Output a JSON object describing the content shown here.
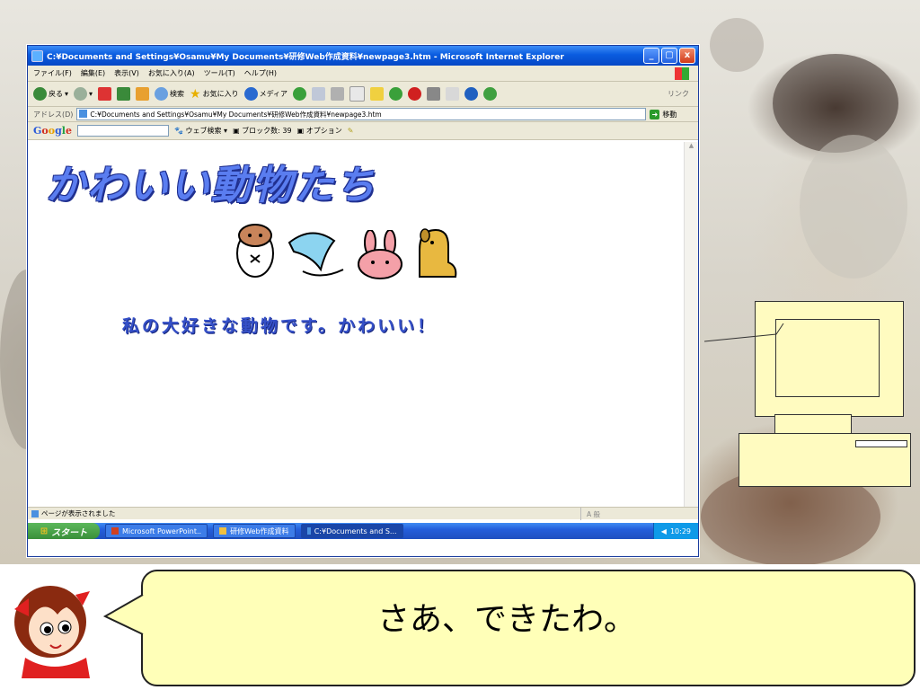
{
  "window": {
    "title": "C:¥Documents and Settings¥Osamu¥My Documents¥研修Web作成資料¥newpage3.htm - Microsoft Internet Explorer",
    "controls": [
      "_",
      "▢",
      "x"
    ]
  },
  "menubar": {
    "items": [
      "ファイル(F)",
      "編集(E)",
      "表示(V)",
      "お気に入り(A)",
      "ツール(T)",
      "ヘルプ(H)"
    ]
  },
  "toolbar": {
    "back": "戻る",
    "search": "検索",
    "favorites": "お気に入り",
    "media": "メディア",
    "links": "リンク"
  },
  "addressbar": {
    "label": "アドレス(D)",
    "value": "C:¥Documents and Settings¥Osamu¥My Documents¥研修Web作成資料¥newpage3.htm",
    "go": "移動"
  },
  "googlebar": {
    "logo": "Google",
    "web_search": "ウェブ検索",
    "blocked": "ブロック数: 39",
    "options": "オプション"
  },
  "page": {
    "heading": "かわいい動物たち",
    "message": "私の大好きな動物です。かわいい！"
  },
  "statusbar": {
    "text": "ページが表示されました",
    "zone": "A 般"
  },
  "taskbar": {
    "start": "スタート",
    "tasks": [
      "Microsoft PowerPoint..",
      "研修Web作成資料",
      "C:¥Documents and S..."
    ],
    "clock": "10:29"
  },
  "bubble": {
    "text": "さあ、できたわ。"
  }
}
